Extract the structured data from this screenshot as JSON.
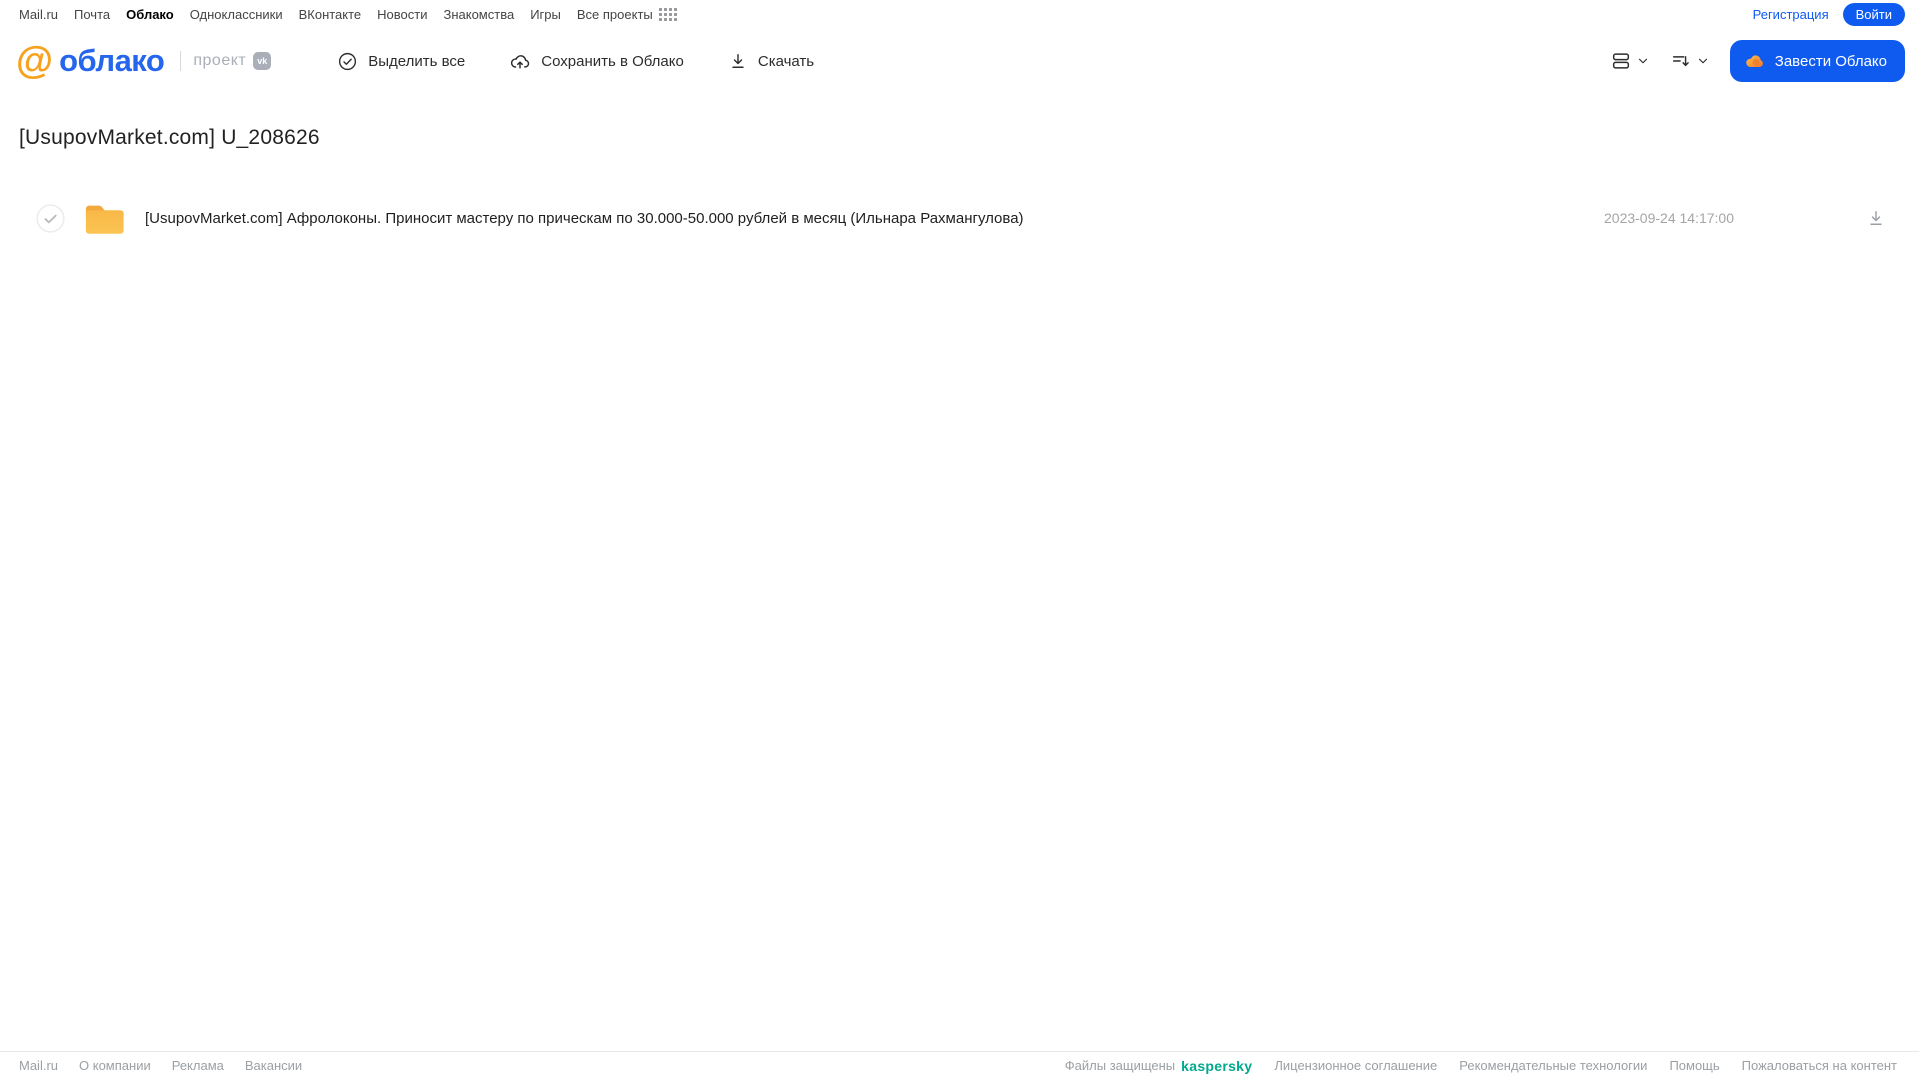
{
  "topnav": {
    "items": [
      {
        "label": "Mail.ru",
        "active": false
      },
      {
        "label": "Почта",
        "active": false
      },
      {
        "label": "Облако",
        "active": true
      },
      {
        "label": "Одноклассники",
        "active": false
      },
      {
        "label": "ВКонтакте",
        "active": false
      },
      {
        "label": "Новости",
        "active": false
      },
      {
        "label": "Знакомства",
        "active": false
      },
      {
        "label": "Игры",
        "active": false
      },
      {
        "label": "Все проекты",
        "active": false
      }
    ],
    "register_label": "Регистрация",
    "login_label": "Войти"
  },
  "header": {
    "logo_at": "@",
    "logo_text": "облако",
    "project_label": "проект",
    "vk_badge": "vk",
    "toolbar": {
      "select_all_label": "Выделить все",
      "save_to_cloud_label": "Сохранить в Облако",
      "download_label": "Скачать"
    },
    "get_cloud_label": "Завести Облако"
  },
  "page": {
    "title": "[UsupovMarket.com] U_208626"
  },
  "files": [
    {
      "type": "folder",
      "name": "[UsupovMarket.com] Афролоконы. Приносит мастеру по прическам по 30.000-50.000 рублей в месяц (Ильнара Рахмангулова)",
      "date": "2023-09-24 14:17:00"
    }
  ],
  "footer": {
    "left_links": [
      "Mail.ru",
      "О компании",
      "Реклама",
      "Вакансии"
    ],
    "protected_label": "Файлы защищены",
    "kaspersky_label": "kaspersky",
    "right_links": [
      "Лицензионное соглашение",
      "Рекомендательные технологии",
      "Помощь",
      "Пожаловаться на контент"
    ]
  },
  "icons": {
    "grid-icon": "4x3 dot grid",
    "check-circle-icon": "circled checkmark",
    "cloud-upload-icon": "cloud with up arrow",
    "download-icon": "down arrow over line",
    "view-mode-icon": "two stacked rows",
    "sort-icon": "lines with down arrow",
    "chevron-down-icon": "˅",
    "cloud-icon": "orange cloud",
    "folder-icon": "yellow folder",
    "checkbox-circle-icon": "circle with gray check"
  },
  "colors": {
    "accent_blue": "#0F5BF0",
    "logo_orange": "#F7A21F",
    "logo_blue": "#2566EC",
    "folder_yellow": "#FBC14F",
    "folder_dark": "#F2A93D",
    "kaspersky_green": "#00A88E",
    "muted_gray": "#9BA0A5"
  }
}
